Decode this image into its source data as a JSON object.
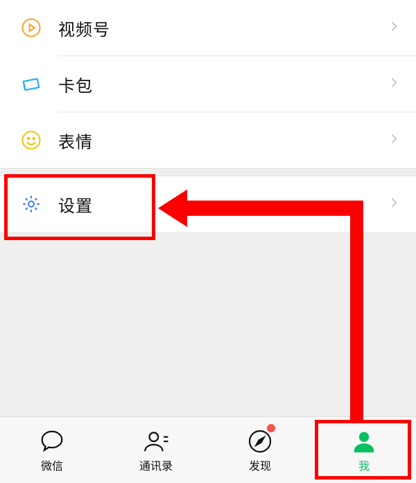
{
  "menu": {
    "channels": {
      "label": "视频号"
    },
    "cards": {
      "label": "卡包"
    },
    "stickers": {
      "label": "表情"
    },
    "settings": {
      "label": "设置"
    }
  },
  "tabs": {
    "chats": {
      "label": "微信"
    },
    "contacts": {
      "label": "通讯录"
    },
    "discover": {
      "label": "发现"
    },
    "me": {
      "label": "我"
    }
  },
  "colors": {
    "accent": "#07c160",
    "annotation": "#fa0000"
  }
}
